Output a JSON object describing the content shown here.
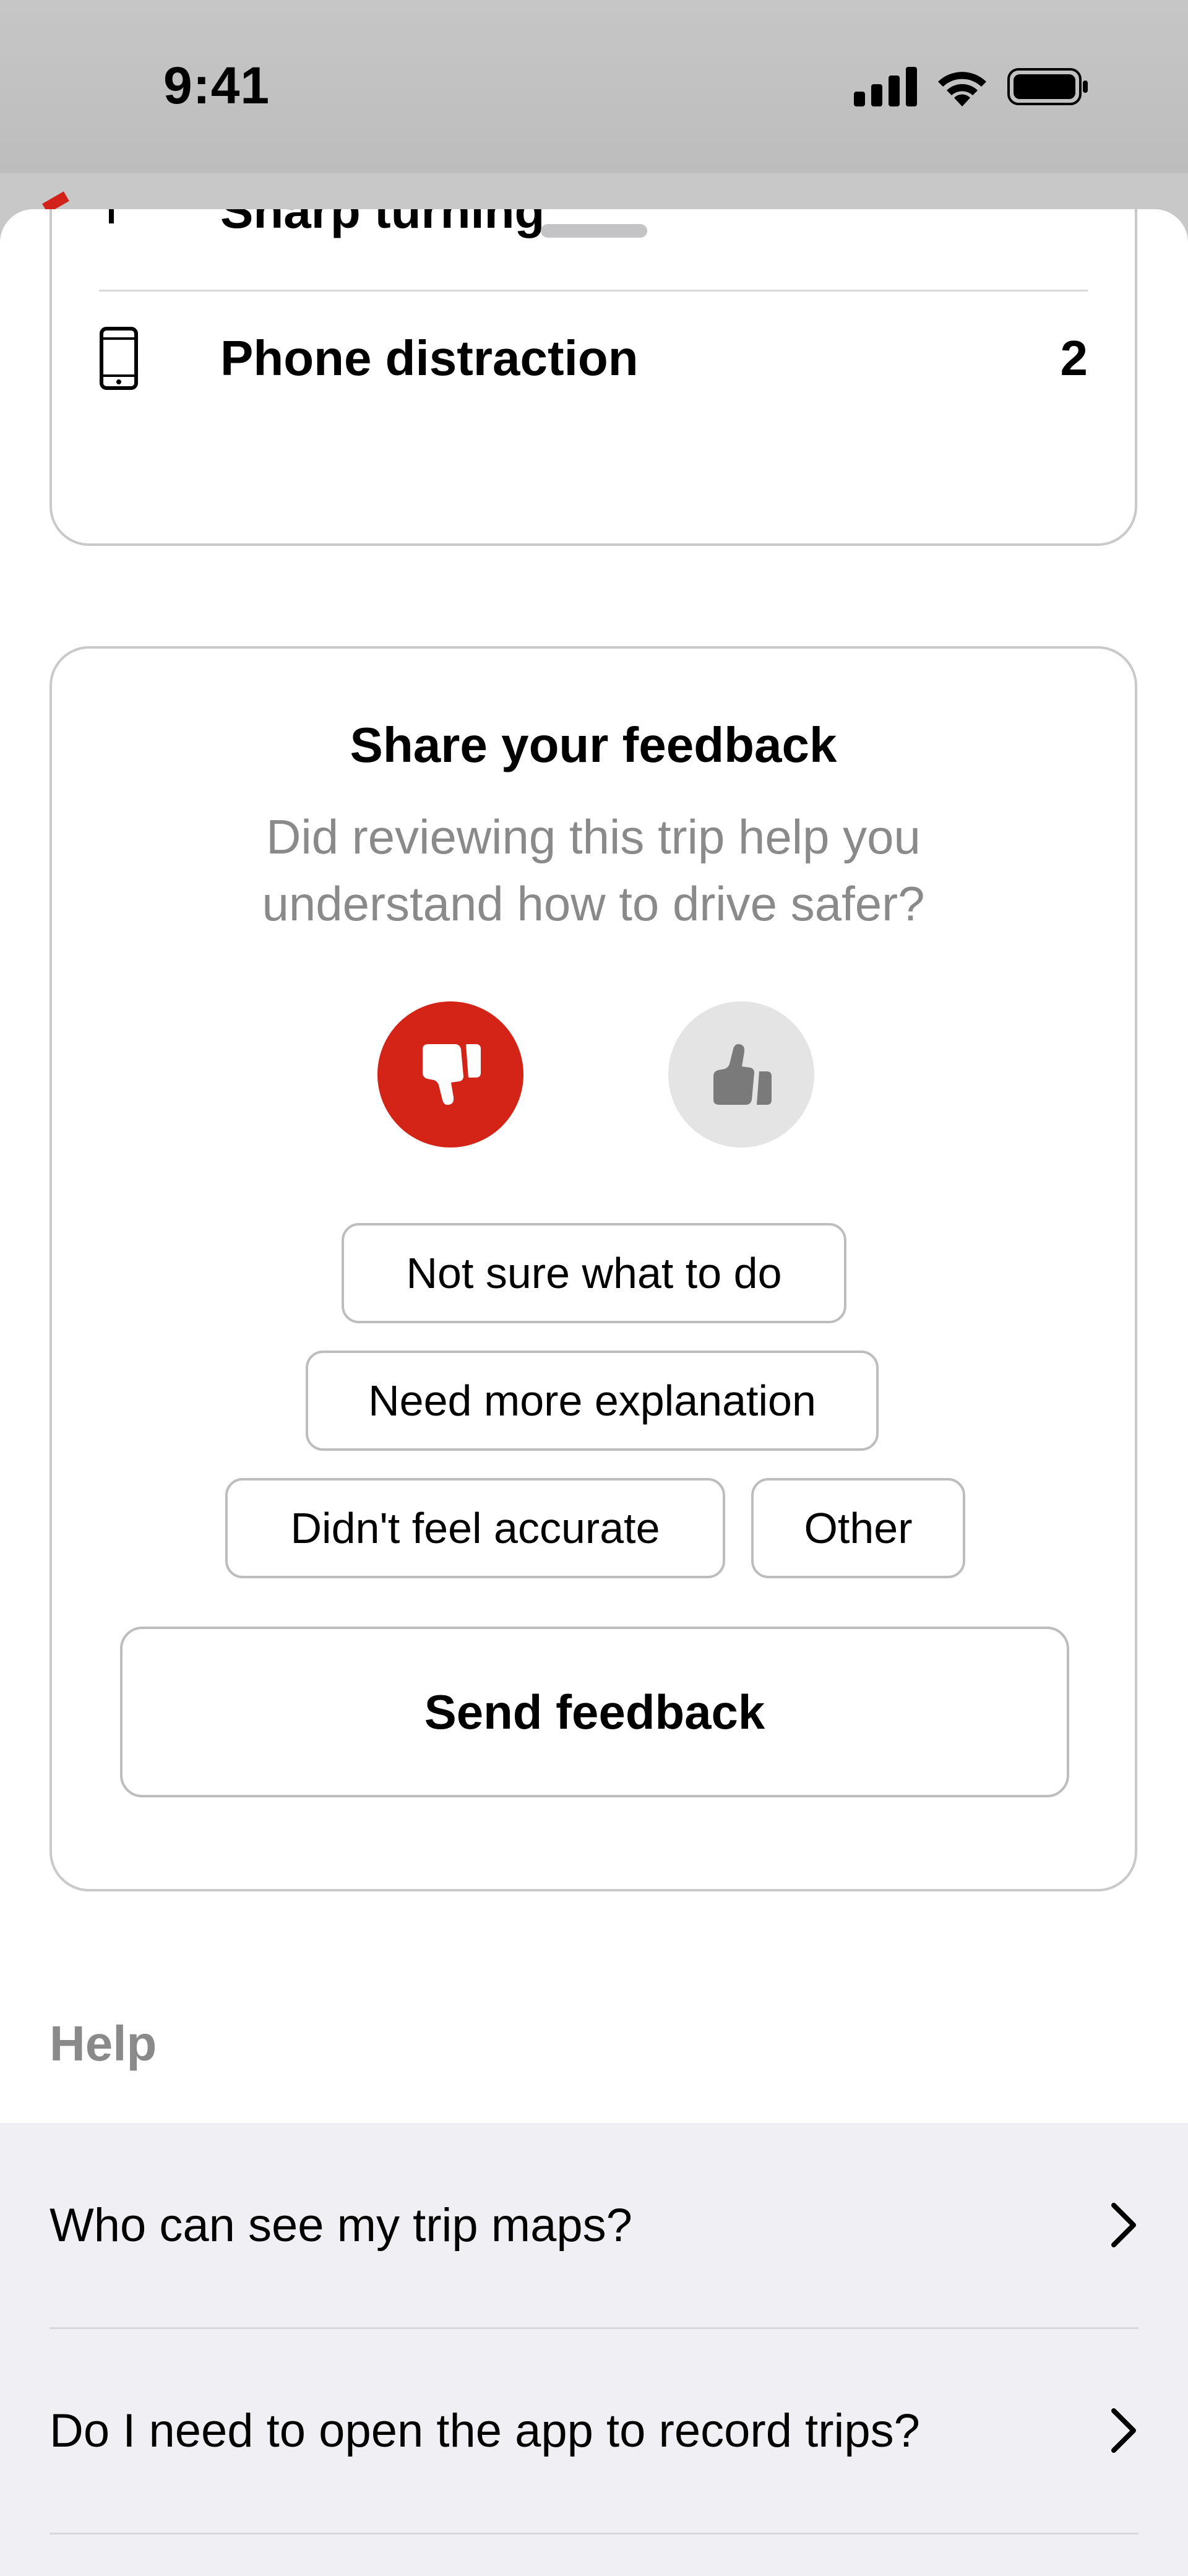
{
  "status_bar": {
    "time": "9:41"
  },
  "trip_events": {
    "partial_item_label": "Sharp turning",
    "items": [
      {
        "label": "Phone distraction",
        "count": "2",
        "icon": "phone-icon"
      }
    ]
  },
  "feedback": {
    "title": "Share your feedback",
    "subtitle": "Did reviewing this trip help you understand how to drive safer?",
    "thumbs_down_icon": "thumbs-down-icon",
    "thumbs_up_icon": "thumbs-up-icon",
    "selected": "thumbs-down",
    "reasons": [
      "Not sure what to do",
      "Need more explanation",
      "Didn't feel accurate",
      "Other"
    ],
    "send_label": "Send feedback"
  },
  "help": {
    "title": "Help",
    "items": [
      "Who can see my trip maps?",
      "Do I need to open the app to record trips?"
    ]
  },
  "colors": {
    "accent_red": "#d42417",
    "muted_text": "#8a8a8a",
    "list_bg": "#f0eff4"
  }
}
